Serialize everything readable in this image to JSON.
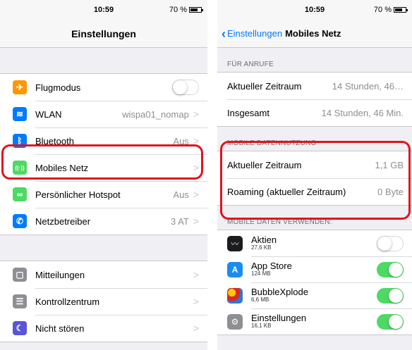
{
  "left": {
    "status": {
      "time": "10:59",
      "battery": "70 %"
    },
    "nav_title": "Einstellungen",
    "group1": [
      {
        "icon": "airplane-icon",
        "color": "#ff9500",
        "glyph": "✈",
        "label": "Flugmodus",
        "toggle": "off"
      },
      {
        "icon": "wifi-icon",
        "color": "#007aff",
        "glyph": "≋",
        "label": "WLAN",
        "value": "wispa01_nomap"
      },
      {
        "icon": "bluetooth-icon",
        "color": "#007aff",
        "glyph": "ᛒ",
        "label": "Bluetooth",
        "value": "Aus"
      },
      {
        "icon": "cellular-icon",
        "color": "#4cd964",
        "glyph": "((·))",
        "label": "Mobiles Netz",
        "value": ""
      },
      {
        "icon": "hotspot-icon",
        "color": "#4cd964",
        "glyph": "∞",
        "label": "Persönlicher Hotspot",
        "value": "Aus"
      },
      {
        "icon": "phone-icon",
        "color": "#007aff",
        "glyph": "✆",
        "label": "Netzbetreiber",
        "value": "3 AT"
      }
    ],
    "group2": [
      {
        "icon": "notifications-icon",
        "color": "#8e8e93",
        "glyph": "▢",
        "label": "Mitteilungen"
      },
      {
        "icon": "control-center-icon",
        "color": "#8e8e93",
        "glyph": "☰",
        "label": "Kontrollzentrum"
      },
      {
        "icon": "do-not-disturb-icon",
        "color": "#5856d6",
        "glyph": "☾",
        "label": "Nicht stören"
      }
    ]
  },
  "right": {
    "status": {
      "time": "10:59",
      "battery": "70 %"
    },
    "back_label": "Einstellungen",
    "nav_title": "Mobiles Netz",
    "calls_header": "FÜR ANRUFE",
    "calls": [
      {
        "label": "Aktueller Zeitraum",
        "value": "14 Stunden, 46…"
      },
      {
        "label": "Insgesamt",
        "value": "14 Stunden, 46 Min."
      }
    ],
    "data_header": "MOBILE DATENNUTZUNG",
    "data": [
      {
        "label": "Aktueller Zeitraum",
        "value": "1,1 GB"
      },
      {
        "label": "Roaming (aktueller Zeitraum)",
        "value": "0 Byte"
      }
    ],
    "apps_header": "MOBILE DATEN VERWENDEN:",
    "apps": [
      {
        "name": "Aktien",
        "size": "27,6 KB",
        "toggle": "off",
        "icon": "stocks-icon",
        "color": "#1c1c1e",
        "glyph": "📈"
      },
      {
        "name": "App Store",
        "size": "124 MB",
        "toggle": "on",
        "icon": "app-store-icon",
        "color": "#1a8cf0",
        "glyph": "A"
      },
      {
        "name": "BubbleXplode",
        "size": "6,6 MB",
        "toggle": "on",
        "icon": "bubblexplode-icon",
        "color": "#8a1a1a",
        "glyph": "●"
      },
      {
        "name": "Einstellungen",
        "size": "16,1 KB",
        "toggle": "on",
        "icon": "settings-icon",
        "color": "#8e8e93",
        "glyph": "⚙"
      }
    ]
  },
  "colors": {
    "accent": "#007aff",
    "highlight": "#e0141e",
    "toggle_on": "#4cd964"
  }
}
